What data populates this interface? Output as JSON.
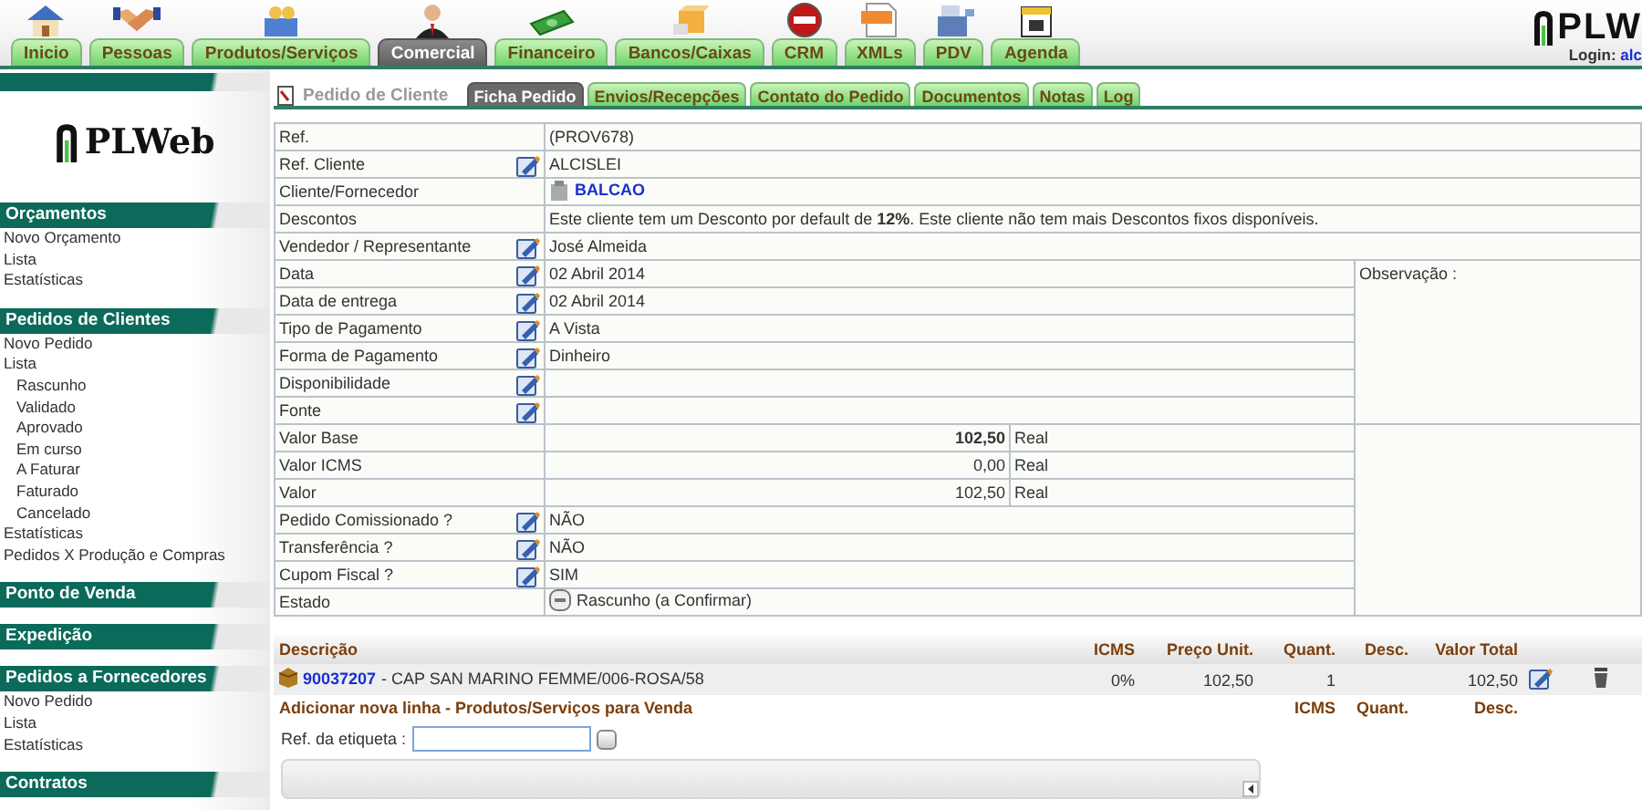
{
  "nav": [
    {
      "label": "Inicio",
      "selected": false
    },
    {
      "label": "Pessoas",
      "selected": false
    },
    {
      "label": "Produtos/Serviços",
      "selected": false
    },
    {
      "label": "Comercial",
      "selected": true
    },
    {
      "label": "Financeiro",
      "selected": false
    },
    {
      "label": "Bancos/Caixas",
      "selected": false
    },
    {
      "label": "CRM",
      "selected": false
    },
    {
      "label": "XMLs",
      "selected": false
    },
    {
      "label": "PDV",
      "selected": false
    },
    {
      "label": "Agenda",
      "selected": false
    }
  ],
  "brand": {
    "logo": "PLW",
    "login_label": "Login:",
    "login_user": "alc"
  },
  "sidebar": {
    "logo": "PLWeb",
    "sections": [
      {
        "title": "Orçamentos",
        "items": [
          {
            "label": "Novo Orçamento"
          },
          {
            "label": "Lista"
          },
          {
            "label": "Estatísticas"
          }
        ]
      },
      {
        "title": "Pedidos de Clientes",
        "items": [
          {
            "label": "Novo Pedido"
          },
          {
            "label": "Lista",
            "children": [
              {
                "label": "Rascunho"
              },
              {
                "label": "Validado"
              },
              {
                "label": "Aprovado"
              },
              {
                "label": "Em curso"
              },
              {
                "label": "A Faturar"
              },
              {
                "label": "Faturado"
              },
              {
                "label": "Cancelado"
              }
            ]
          },
          {
            "label": "Estatísticas"
          },
          {
            "label": "Pedidos X Produção e Compras"
          }
        ]
      },
      {
        "title": "Ponto de Venda"
      },
      {
        "title": "Expedição"
      },
      {
        "title": "Pedidos a Fornecedores",
        "items": [
          {
            "label": "Novo Pedido"
          },
          {
            "label": "Lista"
          },
          {
            "label": "Estatísticas"
          }
        ]
      },
      {
        "title": "Contratos"
      }
    ]
  },
  "page_title": "Pedido de Cliente",
  "tabs": [
    {
      "label": "Ficha Pedido",
      "selected": true
    },
    {
      "label": "Envios/Recepções",
      "selected": false
    },
    {
      "label": "Contato do Pedido",
      "selected": false
    },
    {
      "label": "Documentos",
      "selected": false
    },
    {
      "label": "Notas",
      "selected": false
    },
    {
      "label": "Log",
      "selected": false
    }
  ],
  "top_fields": [
    {
      "label": "Ref.",
      "kind": "text",
      "editable": false,
      "value": "(PROV678)"
    },
    {
      "label": "Ref. Cliente",
      "kind": "text",
      "editable": true,
      "value": "ALCISLEI"
    },
    {
      "label": "Cliente/Fornecedor",
      "kind": "link",
      "editable": false,
      "value": "BALCAO"
    },
    {
      "label": "Descontos",
      "kind": "text",
      "editable": false,
      "value": "Este cliente tem um Desconto por default de **12%**. Este cliente não tem mais Descontos fixos disponíveis."
    },
    {
      "label": "Vendedor / Representante",
      "kind": "text",
      "editable": true,
      "value": "José Almeida"
    }
  ],
  "observation_label": "Observação :",
  "side_fields": [
    {
      "label": "Data",
      "kind": "text",
      "editable": true,
      "value": "02 Abril 2014"
    },
    {
      "label": "Data de entrega",
      "kind": "text",
      "editable": true,
      "value": "02 Abril 2014"
    },
    {
      "label": "Tipo de Pagamento",
      "kind": "text",
      "editable": true,
      "value": "A Vista"
    },
    {
      "label": "Forma de Pagamento",
      "kind": "text",
      "editable": true,
      "value": "Dinheiro"
    },
    {
      "label": "Disponibilidade",
      "kind": "text",
      "editable": true
    },
    {
      "label": "Fonte",
      "kind": "text",
      "editable": true
    },
    {
      "label": "Valor Base",
      "kind": "money",
      "editable": false,
      "value": "102,50",
      "unit": "Real",
      "emphasized": true
    },
    {
      "label": "Valor ICMS",
      "kind": "money",
      "editable": false,
      "value": "0,00",
      "unit": "Real",
      "emphasized": false
    },
    {
      "label": "Valor",
      "kind": "money",
      "editable": false,
      "value": "102,50",
      "unit": "Real",
      "emphasized": false
    },
    {
      "label": "Pedido Comissionado ?",
      "kind": "text",
      "editable": true,
      "value": "NÃO"
    },
    {
      "label": "Transferência ?",
      "kind": "text",
      "editable": true,
      "value": "NÃO"
    },
    {
      "label": "Cupom Fiscal ?",
      "kind": "text",
      "editable": true,
      "value": "SIM"
    },
    {
      "label": "Estado",
      "kind": "status",
      "editable": false,
      "value": "Rascunho (a Confirmar)"
    }
  ],
  "lines": {
    "columns": [
      "Descrição",
      "ICMS",
      "Preço Unit.",
      "Quant.",
      "Desc.",
      "Valor Total"
    ],
    "rows": [
      {
        "ref": "90037207",
        "description": "- CAP SAN MARINO FEMME/006-ROSA/58",
        "icms": "0%",
        "price": "102,50",
        "quantity": "1",
        "total": "102,50"
      }
    ],
    "add_line": {
      "title": "Adicionar nova linha - Produtos/Serviços para Venda",
      "columns": [
        "ICMS",
        "Quant.",
        "Desc."
      ]
    },
    "label_field": {
      "label": "Ref. da etiqueta :"
    }
  }
}
